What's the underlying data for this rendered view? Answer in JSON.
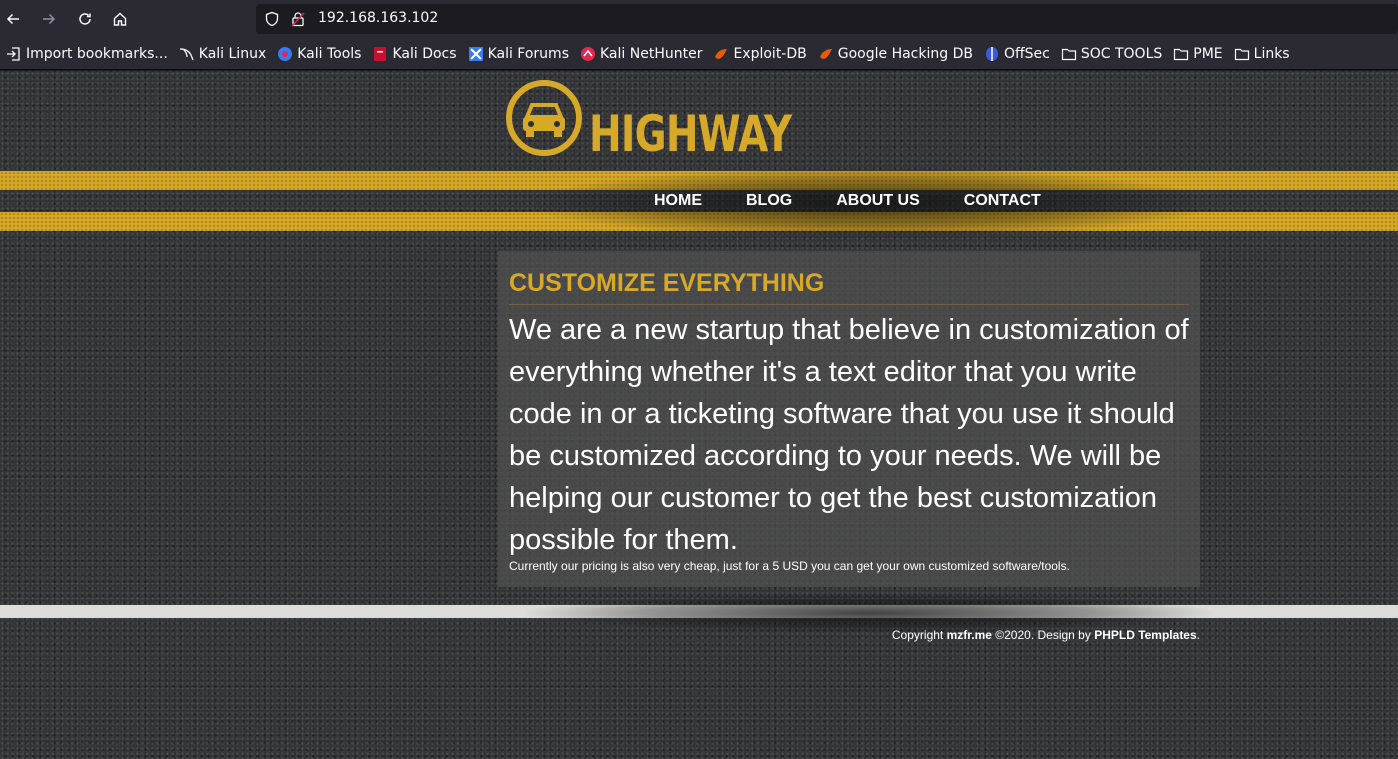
{
  "browser": {
    "url": "192.168.163.102",
    "bookmarks": [
      {
        "label": "Import bookmarks...",
        "icon": "import-icon"
      },
      {
        "label": "Kali Linux",
        "icon": "kali-dragon-icon"
      },
      {
        "label": "Kali Tools",
        "icon": "kali-tools-icon"
      },
      {
        "label": "Kali Docs",
        "icon": "kali-docs-icon"
      },
      {
        "label": "Kali Forums",
        "icon": "kali-forums-icon"
      },
      {
        "label": "Kali NetHunter",
        "icon": "kali-nethunter-icon"
      },
      {
        "label": "Exploit-DB",
        "icon": "exploit-db-icon"
      },
      {
        "label": "Google Hacking DB",
        "icon": "ghdb-icon"
      },
      {
        "label": "OffSec",
        "icon": "offsec-icon"
      },
      {
        "label": "SOC TOOLS",
        "icon": "folder-icon"
      },
      {
        "label": "PME",
        "icon": "folder-icon"
      },
      {
        "label": "Links",
        "icon": "folder-icon"
      }
    ]
  },
  "site": {
    "logo_text": "HIGHWAY",
    "nav": [
      "HOME",
      "BLOG",
      "ABOUT US",
      "CONTACT"
    ],
    "content": {
      "title": "CUSTOMIZE EVERYTHING",
      "paragraph": "We are a new startup that believe in customization of everything whether it's a text editor that you write code in or a ticketing software that you use it should be customized according to your needs. We will be helping our customer to get the best customization possible for them.",
      "note": "Currently our pricing is also very cheap, just for a 5 USD you can get your own customized software/tools."
    },
    "footer": {
      "prefix": "Copyright ",
      "owner": "mzfr.me",
      "middle": " ©2020. Design by ",
      "designer": "PHPLD Templates",
      "suffix": "."
    }
  },
  "colors": {
    "accent_yellow": "#d7a928",
    "chrome_bg": "#2b2a33",
    "url_bg": "#1c1b22"
  }
}
